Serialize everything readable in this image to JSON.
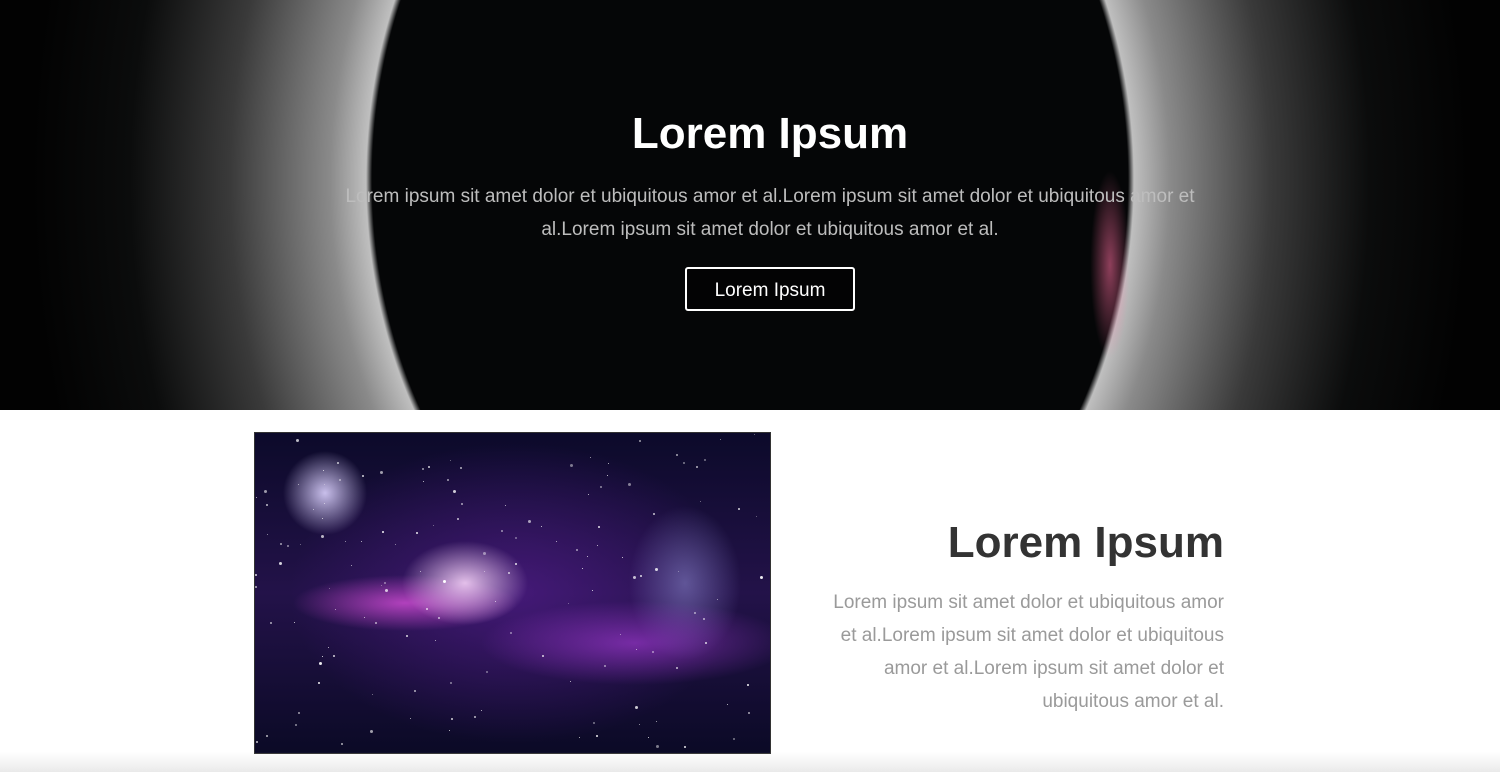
{
  "hero": {
    "title": "Lorem Ipsum",
    "text": "Lorem ipsum sit amet dolor et ubiquitous amor et al.Lorem ipsum sit amet dolor et ubiquitous amor et al.Lorem ipsum sit amet dolor et ubiquitous amor et al.",
    "button_label": "Lorem Ipsum",
    "background_image": "solar-eclipse"
  },
  "feature": {
    "image": "galaxy-nebula",
    "title": "Lorem Ipsum",
    "text": "Lorem ipsum sit amet dolor et ubiquitous amor et al.Lorem ipsum sit amet dolor et ubiquitous amor et al.Lorem ipsum sit amet dolor et ubiquitous amor et al."
  },
  "colors": {
    "hero_background": "#000000",
    "hero_title": "#ffffff",
    "hero_text": "#bdbdbd",
    "section_title": "#333333",
    "section_text": "#9a9a9a"
  }
}
